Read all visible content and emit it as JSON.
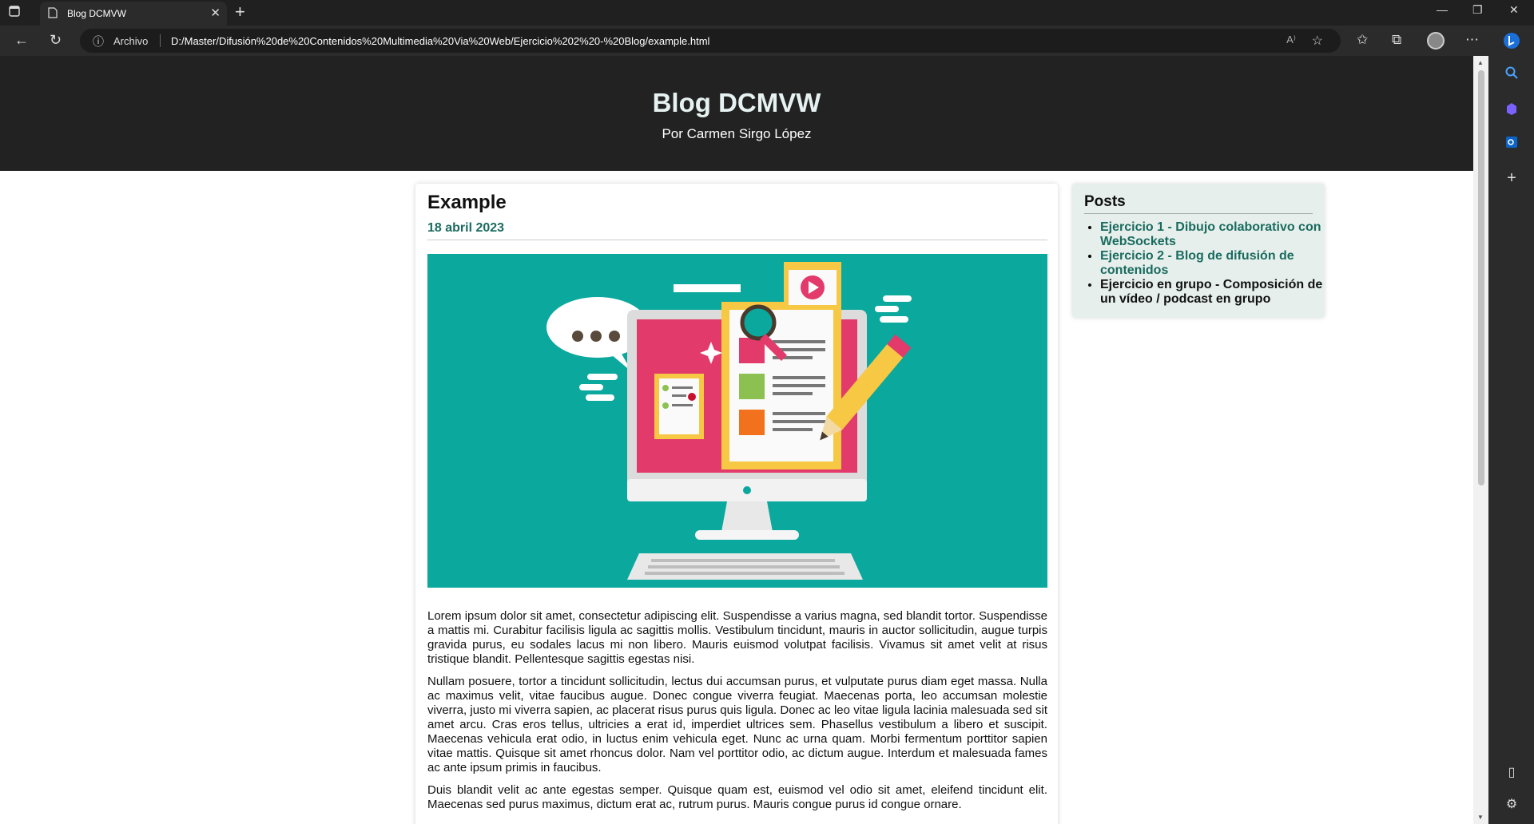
{
  "browser": {
    "tab_title": "Blog DCMVW",
    "scheme_label": "Archivo",
    "url": "D:/Master/Difusión%20de%20Contenidos%20Multimedia%20Via%20Web/Ejercicio%202%20-%20Blog/example.html",
    "read_aloud_label": "A⁾"
  },
  "site": {
    "title": "Blog DCMVW",
    "byline": "Por Carmen Sirgo López"
  },
  "post": {
    "title": "Example",
    "date": "18 abril 2023",
    "paragraphs": [
      "Lorem ipsum dolor sit amet, consectetur adipiscing elit. Suspendisse a varius magna, sed blandit tortor. Suspendisse a mattis mi. Curabitur facilisis ligula ac sagittis mollis. Vestibulum tincidunt, mauris in auctor sollicitudin, augue turpis gravida purus, eu sodales lacus mi non libero. Mauris euismod volutpat facilisis. Vivamus sit amet velit at risus tristique blandit. Pellentesque sagittis egestas nisi.",
      "Nullam posuere, tortor a tincidunt sollicitudin, lectus dui accumsan purus, et vulputate purus diam eget massa. Nulla ac maximus velit, vitae faucibus augue. Donec congue viverra feugiat. Maecenas porta, leo accumsan molestie viverra, justo mi viverra sapien, ac placerat risus purus quis ligula. Donec ac leo vitae ligula lacinia malesuada sed sit amet arcu. Cras eros tellus, ultricies a erat id, imperdiet ultrices sem. Phasellus vestibulum a libero et suscipit. Maecenas vehicula erat odio, in luctus enim vehicula eget. Nunc ac urna quam. Morbi fermentum porttitor sapien vitae mattis. Quisque sit amet rhoncus dolor. Nam vel porttitor odio, ac dictum augue. Interdum et malesuada fames ac ante ipsum primis in faucibus.",
      "Duis blandit velit ac ante egestas semper. Quisque quam est, euismod vel odio sit amet, eleifend tincidunt elit. Maecenas sed purus maximus, dictum erat ac, rutrum purus. Mauris congue purus id congue ornare."
    ]
  },
  "sidebar": {
    "heading": "Posts",
    "items": [
      {
        "label": "Ejercicio 1 - Dibujo colaborativo con WebSockets"
      },
      {
        "label": "Ejercicio 2 - Blog de difusión de contenidos"
      },
      {
        "label": "Ejercicio en grupo - Composición de un vídeo / podcast en grupo"
      }
    ]
  },
  "colors": {
    "header_bg": "#222222",
    "accent_teal": "#1a6b5f",
    "hero_bg": "#0aa89d",
    "sidebar_bg": "#e6efec"
  }
}
